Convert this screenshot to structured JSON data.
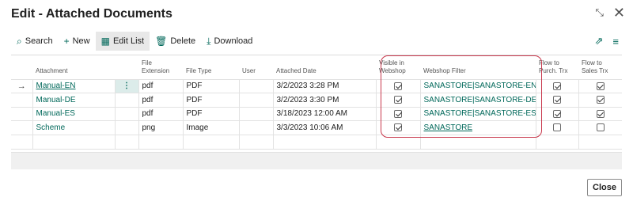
{
  "window": {
    "title": "Edit - Attached Documents",
    "collapse_glyph": "⤡",
    "close_glyph": "✕"
  },
  "toolbar": {
    "search": "Search",
    "new": "New",
    "edit_list": "Edit List",
    "delete": "Delete",
    "download": "Download"
  },
  "columns": {
    "attachment": "Attachment",
    "file_extension": "File Extension",
    "file_type": "File Type",
    "user": "User",
    "attached_date": "Attached Date",
    "visible_webshop": "Visible in Webshop",
    "webshop_filter": "Webshop Filter",
    "flow_purch": "Flow to Purch. Trx",
    "flow_sales": "Flow to Sales Trx"
  },
  "rows": [
    {
      "attachment": "Manual-EN",
      "ext": "pdf",
      "type": "PDF",
      "user": "",
      "date": "3/2/2023 3:28 PM",
      "visible": true,
      "filter": "SANASTORE|SANASTORE-EN",
      "purch": true,
      "sales": true
    },
    {
      "attachment": "Manual-DE",
      "ext": "pdf",
      "type": "PDF",
      "user": "",
      "date": "3/2/2023 3:30 PM",
      "visible": true,
      "filter": "SANASTORE|SANASTORE-DE",
      "purch": true,
      "sales": true
    },
    {
      "attachment": "Manual-ES",
      "ext": "pdf",
      "type": "PDF",
      "user": "",
      "date": "3/18/2023 12:00 AM",
      "visible": true,
      "filter": "SANASTORE|SANASTORE-ES",
      "purch": true,
      "sales": true
    },
    {
      "attachment": "Scheme",
      "ext": "png",
      "type": "Image",
      "user": "",
      "date": "3/3/2023 10:06 AM",
      "visible": true,
      "filter": "SANASTORE",
      "purch": false,
      "sales": false
    }
  ],
  "close_label": "Close",
  "colors": {
    "accent": "#00685a",
    "highlight": "#c8384c"
  }
}
